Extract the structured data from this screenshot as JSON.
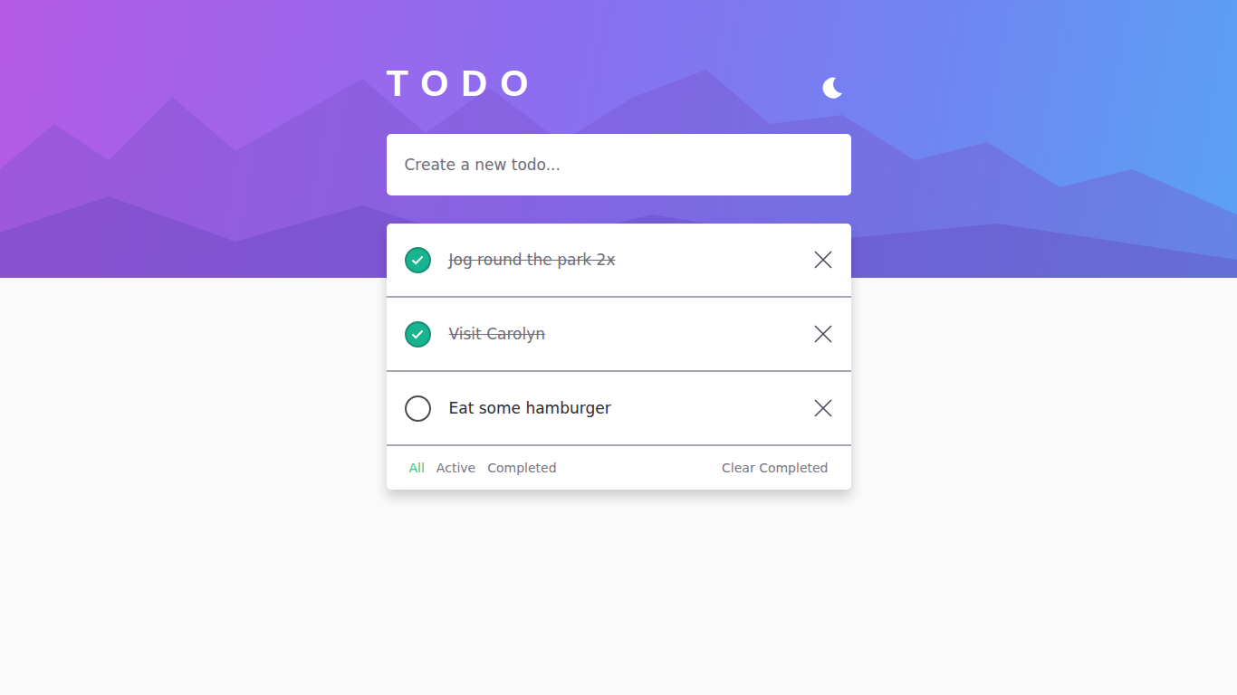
{
  "header": {
    "title": "TODO"
  },
  "new_todo": {
    "placeholder": "Create a new todo..."
  },
  "todos": [
    {
      "text": "Jog round the park 2x",
      "completed": true
    },
    {
      "text": "Visit Carolyn",
      "completed": true
    },
    {
      "text": "Eat some hamburger",
      "completed": false
    }
  ],
  "filters": [
    {
      "label": "All",
      "selected": true
    },
    {
      "label": "Active",
      "selected": false
    },
    {
      "label": "Completed",
      "selected": false
    }
  ],
  "clear_button": {
    "label": "Clear Completed"
  }
}
